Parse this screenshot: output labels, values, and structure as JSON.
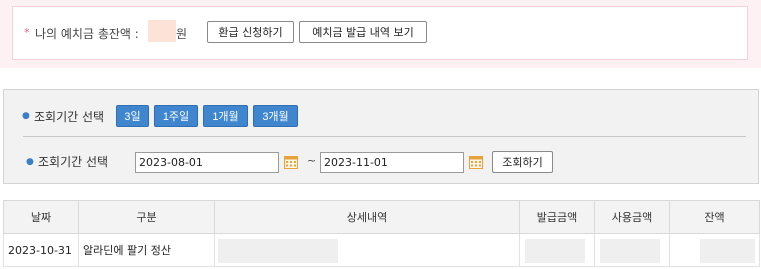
{
  "deposit": {
    "bullet": "*",
    "label": "나의 예치금 총잔액 :",
    "unit": "원",
    "refund_button": "환급 신청하기",
    "history_button": "예치금 발급 내역 보기"
  },
  "search": {
    "period_label_1": "조회기간 선택",
    "period_label_2": "조회기간 선택",
    "period_buttons": [
      "3일",
      "1주일",
      "1개월",
      "3개월"
    ],
    "start_date": "2023-08-01",
    "tilde": "~",
    "end_date": "2023-11-01",
    "search_button": "조회하기",
    "accent_color": "#3f86cf",
    "calendar_icon_color": "#e8a23c"
  },
  "table": {
    "headers": [
      "날짜",
      "구분",
      "상세내역",
      "발급금액",
      "사용금액",
      "잔액"
    ],
    "rows": [
      {
        "date": "2023-10-31",
        "type": "알라딘에 팔기 정산"
      }
    ]
  }
}
